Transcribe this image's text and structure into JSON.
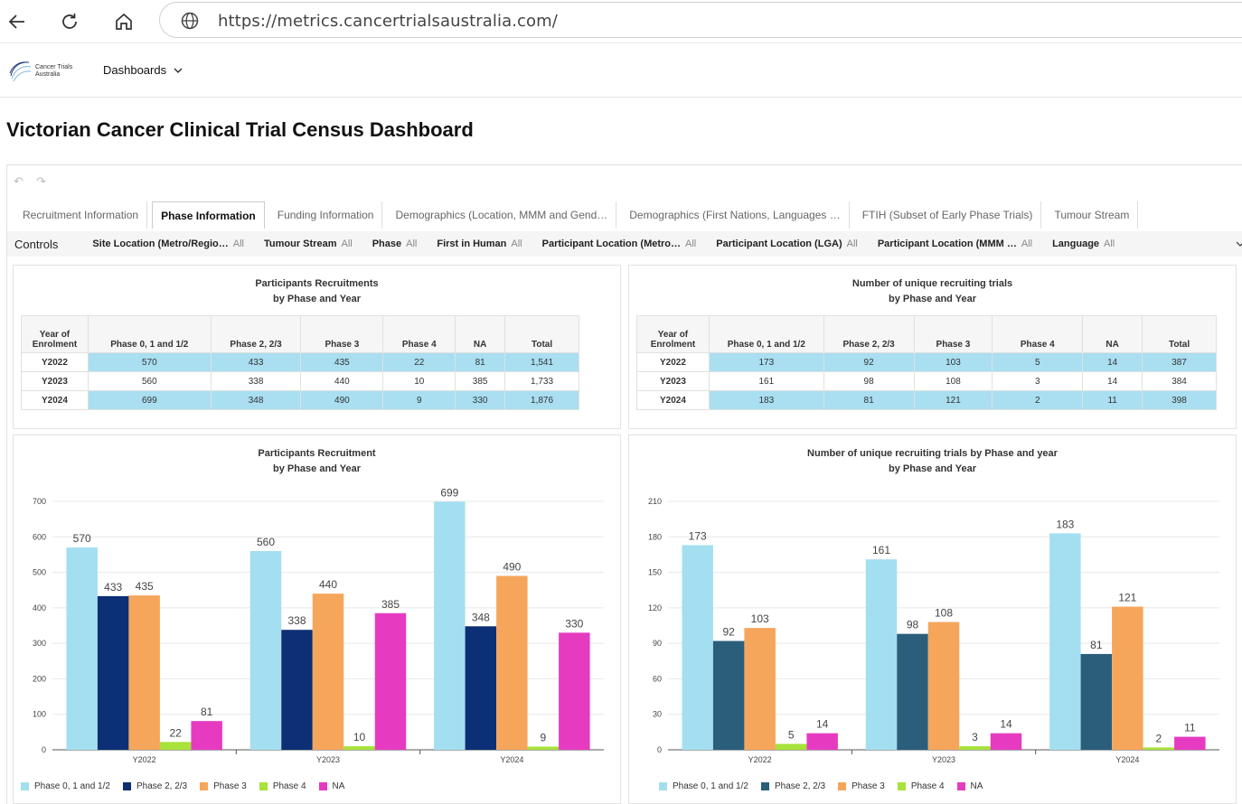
{
  "browser": {
    "url": "https://metrics.cancertrialsaustralia.com/"
  },
  "app": {
    "logo_text_1": "Cancer Trials",
    "logo_text_2": "Australia",
    "dashboards_label": "Dashboards",
    "page_title": "Victorian Cancer Clinical Trial Census Dashboard"
  },
  "tabs": [
    {
      "label": "Recruitment Information",
      "active": false
    },
    {
      "label": "Phase Information",
      "active": true
    },
    {
      "label": "Funding Information",
      "active": false
    },
    {
      "label": "Demographics (Location, MMM and Gend…",
      "active": false
    },
    {
      "label": "Demographics (First Nations, Languages …",
      "active": false
    },
    {
      "label": "FTIH (Subset of Early Phase Trials)",
      "active": false
    },
    {
      "label": "Tumour Stream",
      "active": false
    }
  ],
  "controls": {
    "label": "Controls",
    "items": [
      {
        "name": "Site Location (Metro/Regio…",
        "value": "All"
      },
      {
        "name": "Tumour Stream",
        "value": "All"
      },
      {
        "name": "Phase",
        "value": "All"
      },
      {
        "name": "First in Human",
        "value": "All"
      },
      {
        "name": "Participant Location (Metro…",
        "value": "All"
      },
      {
        "name": "Participant Location (LGA)",
        "value": "All"
      },
      {
        "name": "Participant Location (MMM …",
        "value": "All"
      },
      {
        "name": "Language",
        "value": "All"
      }
    ]
  },
  "colors": {
    "phase01": "#a3dff0",
    "phase23_left": "#0c2f75",
    "phase23_right": "#2b5e7b",
    "phase3": "#f5a65b",
    "phase4": "#a8e23a",
    "na": "#e63bc1",
    "highlight": "#a9dff0"
  },
  "table1": {
    "title_line1": "Participants Recruitments",
    "title_line2": "by Phase and Year",
    "headers": [
      "Year of Enrolment",
      "Phase 0, 1 and 1/2",
      "Phase 2, 2/3",
      "Phase 3",
      "Phase 4",
      "NA",
      "Total"
    ],
    "rows": [
      [
        "Y2022",
        "570",
        "433",
        "435",
        "22",
        "81",
        "1,541"
      ],
      [
        "Y2023",
        "560",
        "338",
        "440",
        "10",
        "385",
        "1,733"
      ],
      [
        "Y2024",
        "699",
        "348",
        "490",
        "9",
        "330",
        "1,876"
      ]
    ]
  },
  "table2": {
    "title_line1": "Number of unique recruiting trials",
    "title_line2": "by Phase and Year",
    "headers": [
      "Year of Enrolment",
      "Phase 0, 1 and 1/2",
      "Phase 2, 2/3",
      "Phase 3",
      "Phase 4",
      "NA",
      "Total"
    ],
    "rows": [
      [
        "Y2022",
        "173",
        "92",
        "103",
        "5",
        "14",
        "387"
      ],
      [
        "Y2023",
        "161",
        "98",
        "108",
        "3",
        "14",
        "384"
      ],
      [
        "Y2024",
        "183",
        "81",
        "121",
        "2",
        "11",
        "398"
      ]
    ]
  },
  "chart_data": [
    {
      "type": "bar",
      "title": "Participants Recruitment",
      "subtitle": "by Phase and Year",
      "categories": [
        "Y2022",
        "Y2023",
        "Y2024"
      ],
      "series": [
        {
          "name": "Phase 0, 1 and 1/2",
          "values": [
            570,
            560,
            699
          ]
        },
        {
          "name": "Phase 2, 2/3",
          "values": [
            433,
            338,
            348
          ]
        },
        {
          "name": "Phase 3",
          "values": [
            435,
            440,
            490
          ]
        },
        {
          "name": "Phase 4",
          "values": [
            22,
            10,
            9
          ]
        },
        {
          "name": "NA",
          "values": [
            81,
            385,
            330
          ]
        }
      ],
      "ylim": [
        0,
        700
      ],
      "yticks": [
        0,
        100,
        200,
        300,
        400,
        500,
        600,
        700
      ],
      "grid": true,
      "legend": "bottom-left"
    },
    {
      "type": "bar",
      "title": "Number of unique recruiting trials by Phase and year",
      "subtitle": "by Phase and Year",
      "categories": [
        "Y2022",
        "Y2023",
        "Y2024"
      ],
      "series": [
        {
          "name": "Phase 0, 1 and 1/2",
          "values": [
            173,
            161,
            183
          ]
        },
        {
          "name": "Phase 2, 2/3",
          "values": [
            92,
            98,
            81
          ]
        },
        {
          "name": "Phase 3",
          "values": [
            103,
            108,
            121
          ]
        },
        {
          "name": "Phase 4",
          "values": [
            5,
            3,
            2
          ]
        },
        {
          "name": "NA",
          "values": [
            14,
            14,
            11
          ]
        }
      ],
      "ylim": [
        0,
        210
      ],
      "yticks": [
        0,
        30,
        60,
        90,
        120,
        150,
        180,
        210
      ],
      "grid": true,
      "legend": "bottom-left"
    }
  ]
}
